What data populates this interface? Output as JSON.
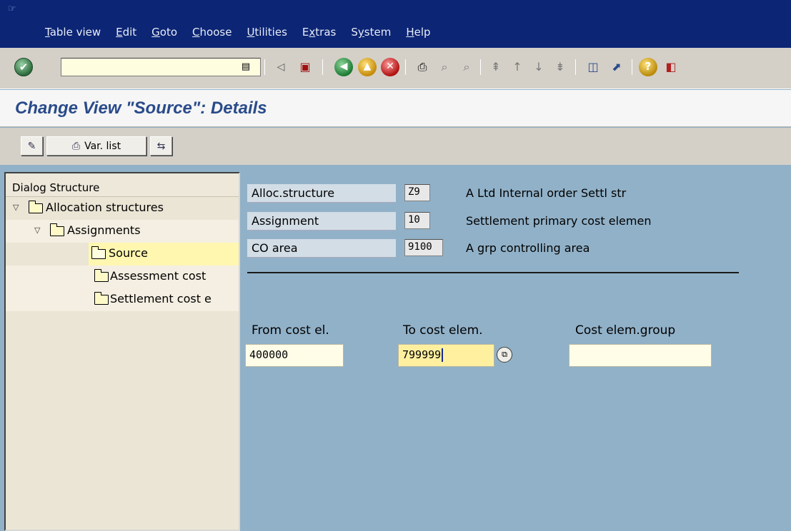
{
  "menubar": {
    "items": [
      {
        "label": "Table view",
        "u": "T"
      },
      {
        "label": "Edit",
        "u": "E"
      },
      {
        "label": "Goto",
        "u": "G"
      },
      {
        "label": "Choose",
        "u": "C"
      },
      {
        "label": "Utilities",
        "u": "U"
      },
      {
        "label": "Extras",
        "u": "x"
      },
      {
        "label": "System",
        "u": "y"
      },
      {
        "label": "Help",
        "u": "H"
      }
    ]
  },
  "toolbar": {
    "command_value": "",
    "icons": [
      "enter-icon",
      "back-icon",
      "save-icon",
      "back-green-icon",
      "exit-icon",
      "cancel-icon",
      "print-icon",
      "find-icon",
      "find-next-icon",
      "first-page-icon",
      "previous-page-icon",
      "next-page-icon",
      "last-page-icon",
      "new-session-icon",
      "shortcut-icon",
      "help-icon",
      "layout-icon"
    ]
  },
  "page": {
    "title": "Change View \"Source\": Details"
  },
  "app_toolbar": {
    "var_list_label": "Var. list"
  },
  "dialog_structure": {
    "header": "Dialog Structure",
    "items": [
      {
        "label": "Allocation structures",
        "level": 0,
        "expanded": true
      },
      {
        "label": "Assignments",
        "level": 1,
        "expanded": true
      },
      {
        "label": "Source",
        "level": 2,
        "selected": true
      },
      {
        "label": "Assessment cost",
        "level": 2
      },
      {
        "label": "Settlement cost e",
        "level": 2
      }
    ]
  },
  "details": {
    "rows": [
      {
        "label": "Alloc.structure",
        "value": "Z9",
        "description": "A Ltd Internal order Settl str"
      },
      {
        "label": "Assignment",
        "value": "10",
        "description": "Settlement primary cost elemen"
      },
      {
        "label": "CO area",
        "value": "9100",
        "description": "A grp controlling area"
      }
    ],
    "from_label": "From cost el.",
    "to_label": "To cost elem.",
    "group_label": "Cost elem.group",
    "from_value": "400000",
    "to_value": "799999",
    "group_value": ""
  },
  "colors": {
    "menubar_bg": "#0c2575",
    "content_bg": "#91b1c8",
    "title_text": "#2a4b8a",
    "active_input": "#fff0a0"
  }
}
